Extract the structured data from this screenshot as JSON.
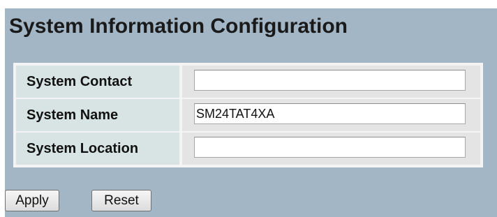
{
  "page": {
    "title": "System Information Configuration"
  },
  "form": {
    "fields": [
      {
        "label": "System Contact",
        "value": ""
      },
      {
        "label": "System Name",
        "value": "SM24TAT4XA"
      },
      {
        "label": "System Location",
        "value": ""
      }
    ]
  },
  "buttons": {
    "apply": "Apply",
    "reset": "Reset"
  },
  "colors": {
    "panel_background": "#a2b6c6",
    "label_cell": "#d8e4e4",
    "value_cell": "#e4e4e4"
  }
}
